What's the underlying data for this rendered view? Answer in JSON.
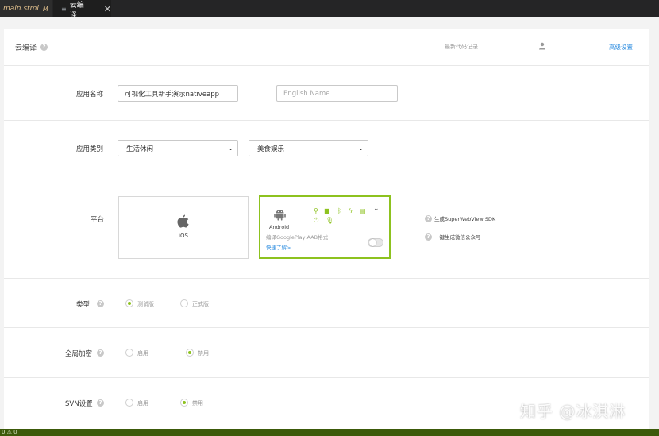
{
  "tabs": [
    {
      "label": "main.stml",
      "modified": "M"
    },
    {
      "label": "云编译",
      "close": "✕"
    }
  ],
  "header": {
    "title": "云编译",
    "latest_code": "最新代码记录",
    "advanced": "高级设置"
  },
  "app_name": {
    "label": "应用名称",
    "value": "可视化工具新手演示nativeapp",
    "english_placeholder": "English Name"
  },
  "category": {
    "label": "应用类别",
    "primary": "生活休闲",
    "secondary": "美食娱乐"
  },
  "platform": {
    "label": "平台",
    "ios": "iOS",
    "android": "Android",
    "android_note": "编译GooglePlay AAB格式",
    "learn_more": "快速了解>",
    "aab_enabled": false,
    "superwebview": "生成SuperWebView SDK",
    "wechat": "一键生成微信公众号"
  },
  "build_type": {
    "label": "类型",
    "options": [
      "测试版",
      "正式版"
    ],
    "selected": "测试版"
  },
  "encryption": {
    "label": "全局加密",
    "options": [
      "启用",
      "禁用"
    ],
    "selected": "禁用"
  },
  "svn": {
    "label": "SVN设置",
    "options": [
      "启用",
      "禁用"
    ],
    "selected": "禁用"
  },
  "status": {
    "text": "0 ⚠ 0"
  },
  "watermark": "知乎 @冰淇淋",
  "colors": {
    "accent": "#8dc21f",
    "link": "#2f8ee0"
  }
}
